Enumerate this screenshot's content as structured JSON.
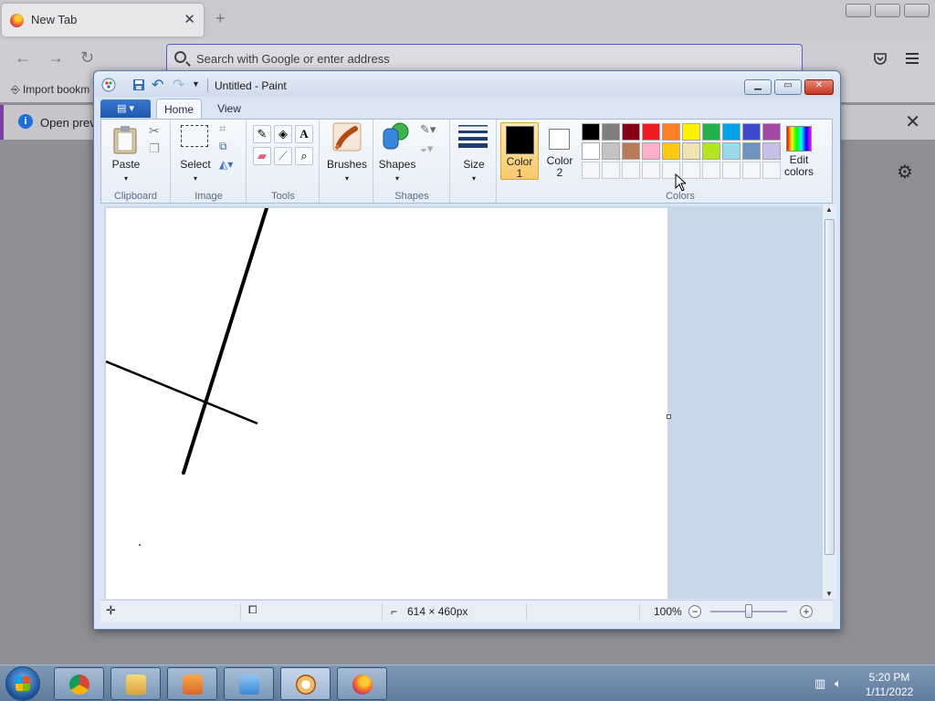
{
  "firefox": {
    "tab_title": "New Tab",
    "tab_close": "✕",
    "new_tab": "+",
    "search_placeholder": "Search with Google or enter address",
    "bookmark_item": "Import bookm",
    "notice_text": "Open previ",
    "notice_close": "✕"
  },
  "paint": {
    "title": "Untitled - Paint",
    "tabs": {
      "home": "Home",
      "view": "View"
    },
    "help": "?",
    "groups": {
      "clipboard": "Clipboard",
      "image": "Image",
      "tools": "Tools",
      "shapes": "Shapes",
      "colors": "Colors"
    },
    "buttons": {
      "paste": "Paste",
      "select": "Select",
      "brushes": "Brushes",
      "shapes": "Shapes",
      "size": "Size",
      "color1_line1": "Color",
      "color1_line2": "1",
      "color2_line1": "Color",
      "color2_line2": "2",
      "edit_colors_line1": "Edit",
      "edit_colors_line2": "colors"
    },
    "color1": "#000000",
    "color2": "#ffffff",
    "palette_row1": [
      "#000000",
      "#7f7f7f",
      "#880015",
      "#ed1c24",
      "#ff7f27",
      "#fff200",
      "#22b14c",
      "#00a2e8",
      "#3f48cc",
      "#a349a4"
    ],
    "palette_row2": [
      "#ffffff",
      "#c3c3c3",
      "#b97a57",
      "#ffaec9",
      "#ffc90e",
      "#efe4b0",
      "#b5e61d",
      "#99d9ea",
      "#7092be",
      "#c8bfe7"
    ],
    "status": {
      "canvas_size": "614 × 460px",
      "zoom": "100%"
    }
  },
  "taskbar": {
    "time": "5:20 PM",
    "date": "1/11/2022"
  }
}
